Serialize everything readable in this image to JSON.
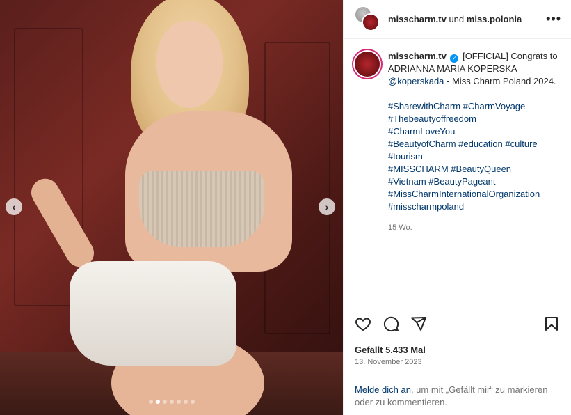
{
  "header": {
    "account_primary": "misscharm.tv",
    "connector": "und",
    "account_secondary": "miss.polonia",
    "more_label": "•••"
  },
  "caption": {
    "username": "misscharm.tv",
    "verified_glyph": "✓",
    "intro": "[OFFICIAL] Congrats to ADRIANNA MARIA KOPERSKA",
    "mention": "@koperskada",
    "outro": "- Miss Charm Poland 2024.",
    "hashtag_lines": [
      "#SharewithCharm #CharmVoyage",
      "#Thebeautyoffreedom",
      "#CharmLoveYou",
      "#BeautyofCharm #education #culture",
      "#tourism",
      "#MISSCHARM #BeautyQueen",
      "#Vietnam #BeautyPageant",
      "#MissCharmInternationalOrganization",
      "#misscharmpoland"
    ],
    "time_ago": "15 Wo."
  },
  "media": {
    "prev_glyph": "‹",
    "next_glyph": "›",
    "slide_count": 7,
    "active_slide": 2
  },
  "stats": {
    "likes": "Gefällt 5.433 Mal",
    "date": "13. November 2023"
  },
  "login": {
    "link_text": "Melde dich an",
    "rest_text": ", um mit „Gefällt mir“ zu markieren oder zu kommentieren."
  },
  "icons": [
    "heart-icon",
    "comment-icon",
    "share-icon",
    "bookmark-icon",
    "more-icon",
    "verified-icon"
  ],
  "colors": {
    "link": "#00376b",
    "verified": "#0095f6",
    "muted": "#737373"
  }
}
